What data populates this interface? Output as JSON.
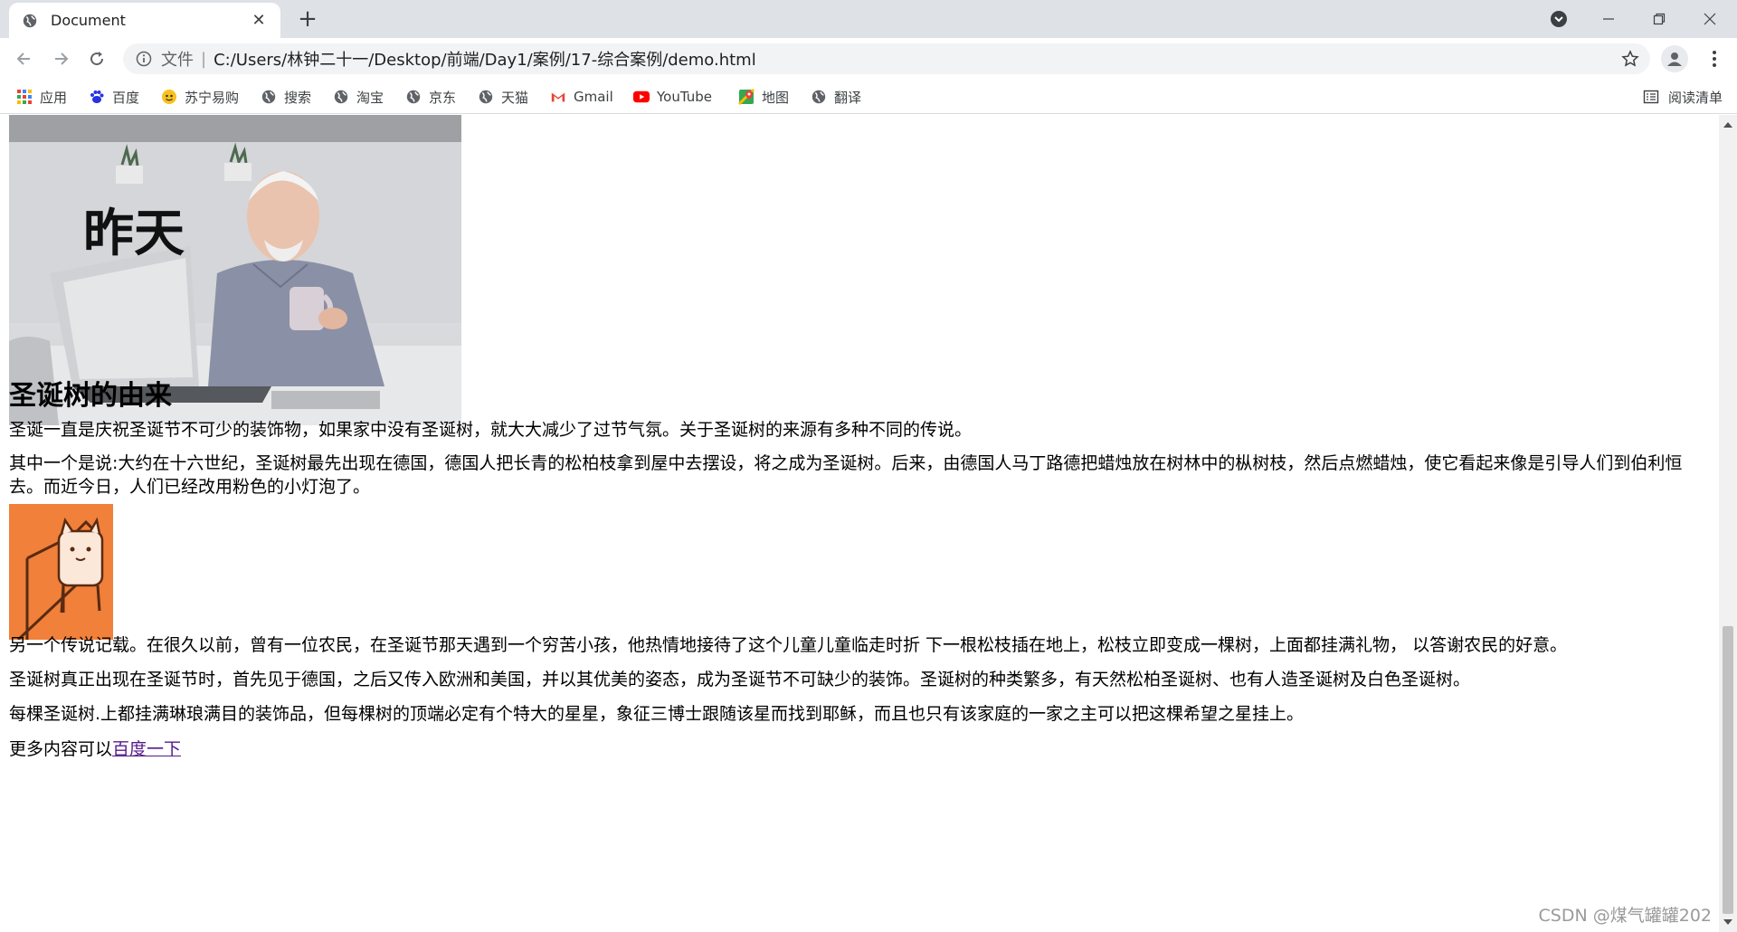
{
  "browser": {
    "tab_title": "Document",
    "tab_close": "✕",
    "new_tab": "+",
    "file_label": "文件",
    "separator": "|",
    "url": "C:/Users/林钟二十一/Desktop/前端/Day1/案例/17-综合案例/demo.html"
  },
  "bookmarks": {
    "items": [
      {
        "label": "应用",
        "icon": "apps-grid-icon"
      },
      {
        "label": "百度",
        "icon": "baidu-paw-icon"
      },
      {
        "label": "苏宁易购",
        "icon": "suning-icon"
      },
      {
        "label": "搜索",
        "icon": "globe-icon"
      },
      {
        "label": "淘宝",
        "icon": "globe-icon"
      },
      {
        "label": "京东",
        "icon": "globe-icon"
      },
      {
        "label": "天猫",
        "icon": "globe-icon"
      },
      {
        "label": "Gmail",
        "icon": "gmail-icon"
      },
      {
        "label": "YouTube",
        "icon": "youtube-icon"
      },
      {
        "label": "地图",
        "icon": "maps-icon"
      },
      {
        "label": "翻译",
        "icon": "globe-icon"
      }
    ],
    "reading_list": "阅读清单"
  },
  "page": {
    "hero_word": "昨天",
    "heading": "圣诞树的由来",
    "p1": "圣诞一直是庆祝圣诞节不可少的装饰物，如果家中没有圣诞树，就大大减少了过节气氛。关于圣诞树的来源有多种不同的传说。",
    "p2": "其中一个是说:大约在十六世纪，圣诞树最先出现在德国，德国人把长青的松柏枝拿到屋中去摆设，将之成为圣诞树。后来，由德国人马丁路德把蜡烛放在树林中的枞树枝，然后点燃蜡烛，使它看起来像是引导人们到伯利恒去。而近今日，人们已经改用粉色的小灯泡了。",
    "p3": "另一个传说记载。在很久以前，曾有一位农民，在圣诞节那天遇到一个穷苦小孩，他热情地接待了这个儿童儿童临走时折 下一根松枝插在地上，松枝立即变成一棵树，上面都挂满礼物， 以答谢农民的好意。",
    "p4": "圣诞树真正出现在圣诞节时，首先见于德国，之后又传入欧洲和美国，并以其优美的姿态，成为圣诞节不可缺少的装饰。圣诞树的种类繁多，有天然松柏圣诞树、也有人造圣诞树及白色圣诞树。",
    "p5": "每棵圣诞树.上都挂满琳琅满目的装饰品，但每棵树的顶端必定有个特大的星星，象征三博士跟随该星而找到耶稣，而且也只有该家庭的一家之主可以把这棵希望之星挂上。",
    "more_prefix": "更多内容可以",
    "more_link": "百度一下",
    "watermark": "CSDN @煤气罐罐202"
  },
  "colors": {
    "tabstrip": "#dee1e6",
    "link_visited": "#551a8b",
    "cat_bg": "#f0803a"
  }
}
